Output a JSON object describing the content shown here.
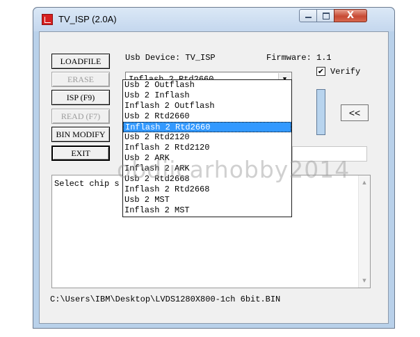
{
  "window": {
    "title": "TV_ISP (2.0A)",
    "close_glyph": "X"
  },
  "buttons": [
    {
      "name": "loadfile-button",
      "label": "LOADFILE",
      "state": "normal"
    },
    {
      "name": "erase-button",
      "label": "ERASE",
      "state": "disabled"
    },
    {
      "name": "isp-button",
      "label": "ISP (F9)",
      "state": "normal"
    },
    {
      "name": "read-button",
      "label": "READ (F7)",
      "state": "disabled"
    },
    {
      "name": "bin-modify-button",
      "label": "BIN MODIFY",
      "state": "normal"
    },
    {
      "name": "exit-button",
      "label": "EXIT",
      "state": "default"
    }
  ],
  "usb_device_label": "Usb Device: TV_ISP",
  "firmware_label": "Firmware: 1.1",
  "chip_select": {
    "value": "Inflash 2 Rtd2660",
    "options": [
      "Usb 2 Outflash",
      "Usb 2 Inflash",
      "Inflash 2 Outflash",
      "Usb 2 Rtd2660",
      "Inflash 2 Rtd2660",
      "Usb 2 Rtd2120",
      "Inflash 2 Rtd2120",
      "Usb 2 ARK",
      "Inflash 2 ARK",
      "Usb 2 Rtd2668",
      "Inflash 2 Rtd2668",
      "Usb 2 MST",
      "Inflash 2 MST"
    ],
    "selected_index": 4
  },
  "verify": {
    "label": "Verify",
    "checked": true,
    "check_glyph": "✔"
  },
  "collapse_button_label": "<<",
  "log_text": "Select chip s",
  "file_path": "C:\\Users\\IBM\\Desktop\\LVDS1280X800-1ch 6bit.BIN",
  "watermark": "obdiicarhobby2014"
}
